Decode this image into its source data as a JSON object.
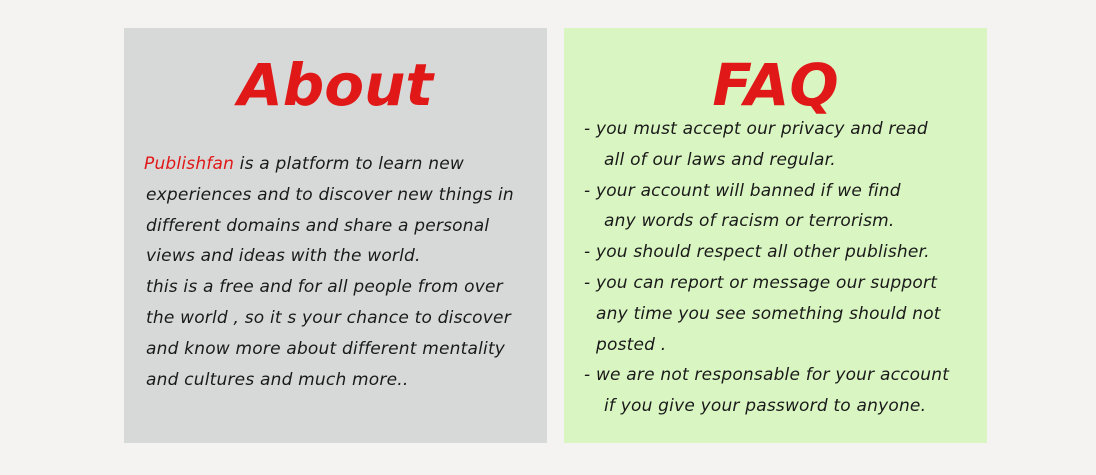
{
  "about": {
    "title": "About",
    "brand": "Publishfan",
    "lines": [
      " is a platform to learn new",
      "experiences and to discover new things in",
      "different domains and share a personal",
      "views and ideas with the world.",
      "this is a free and for all people from over",
      "the world , so it s your chance to discover",
      "and know more about different mentality",
      "and cultures and much more.."
    ]
  },
  "faq": {
    "title": "FAQ",
    "lines": [
      "- you must accept our privacy and read",
      "all of our laws and regular.",
      "- your account will banned if we find",
      "any words of racism or terrorism.",
      "- you should respect all other publisher.",
      "- you can report or message our support",
      "any time you see something should not",
      "posted .",
      "- we are not responsable for your account",
      "if you give your password to anyone."
    ]
  },
  "colors": {
    "accent": "#e11818",
    "about_bg": "#d7d9d9",
    "faq_bg": "#d9f5c1",
    "page_bg": "#f4f3f2"
  }
}
